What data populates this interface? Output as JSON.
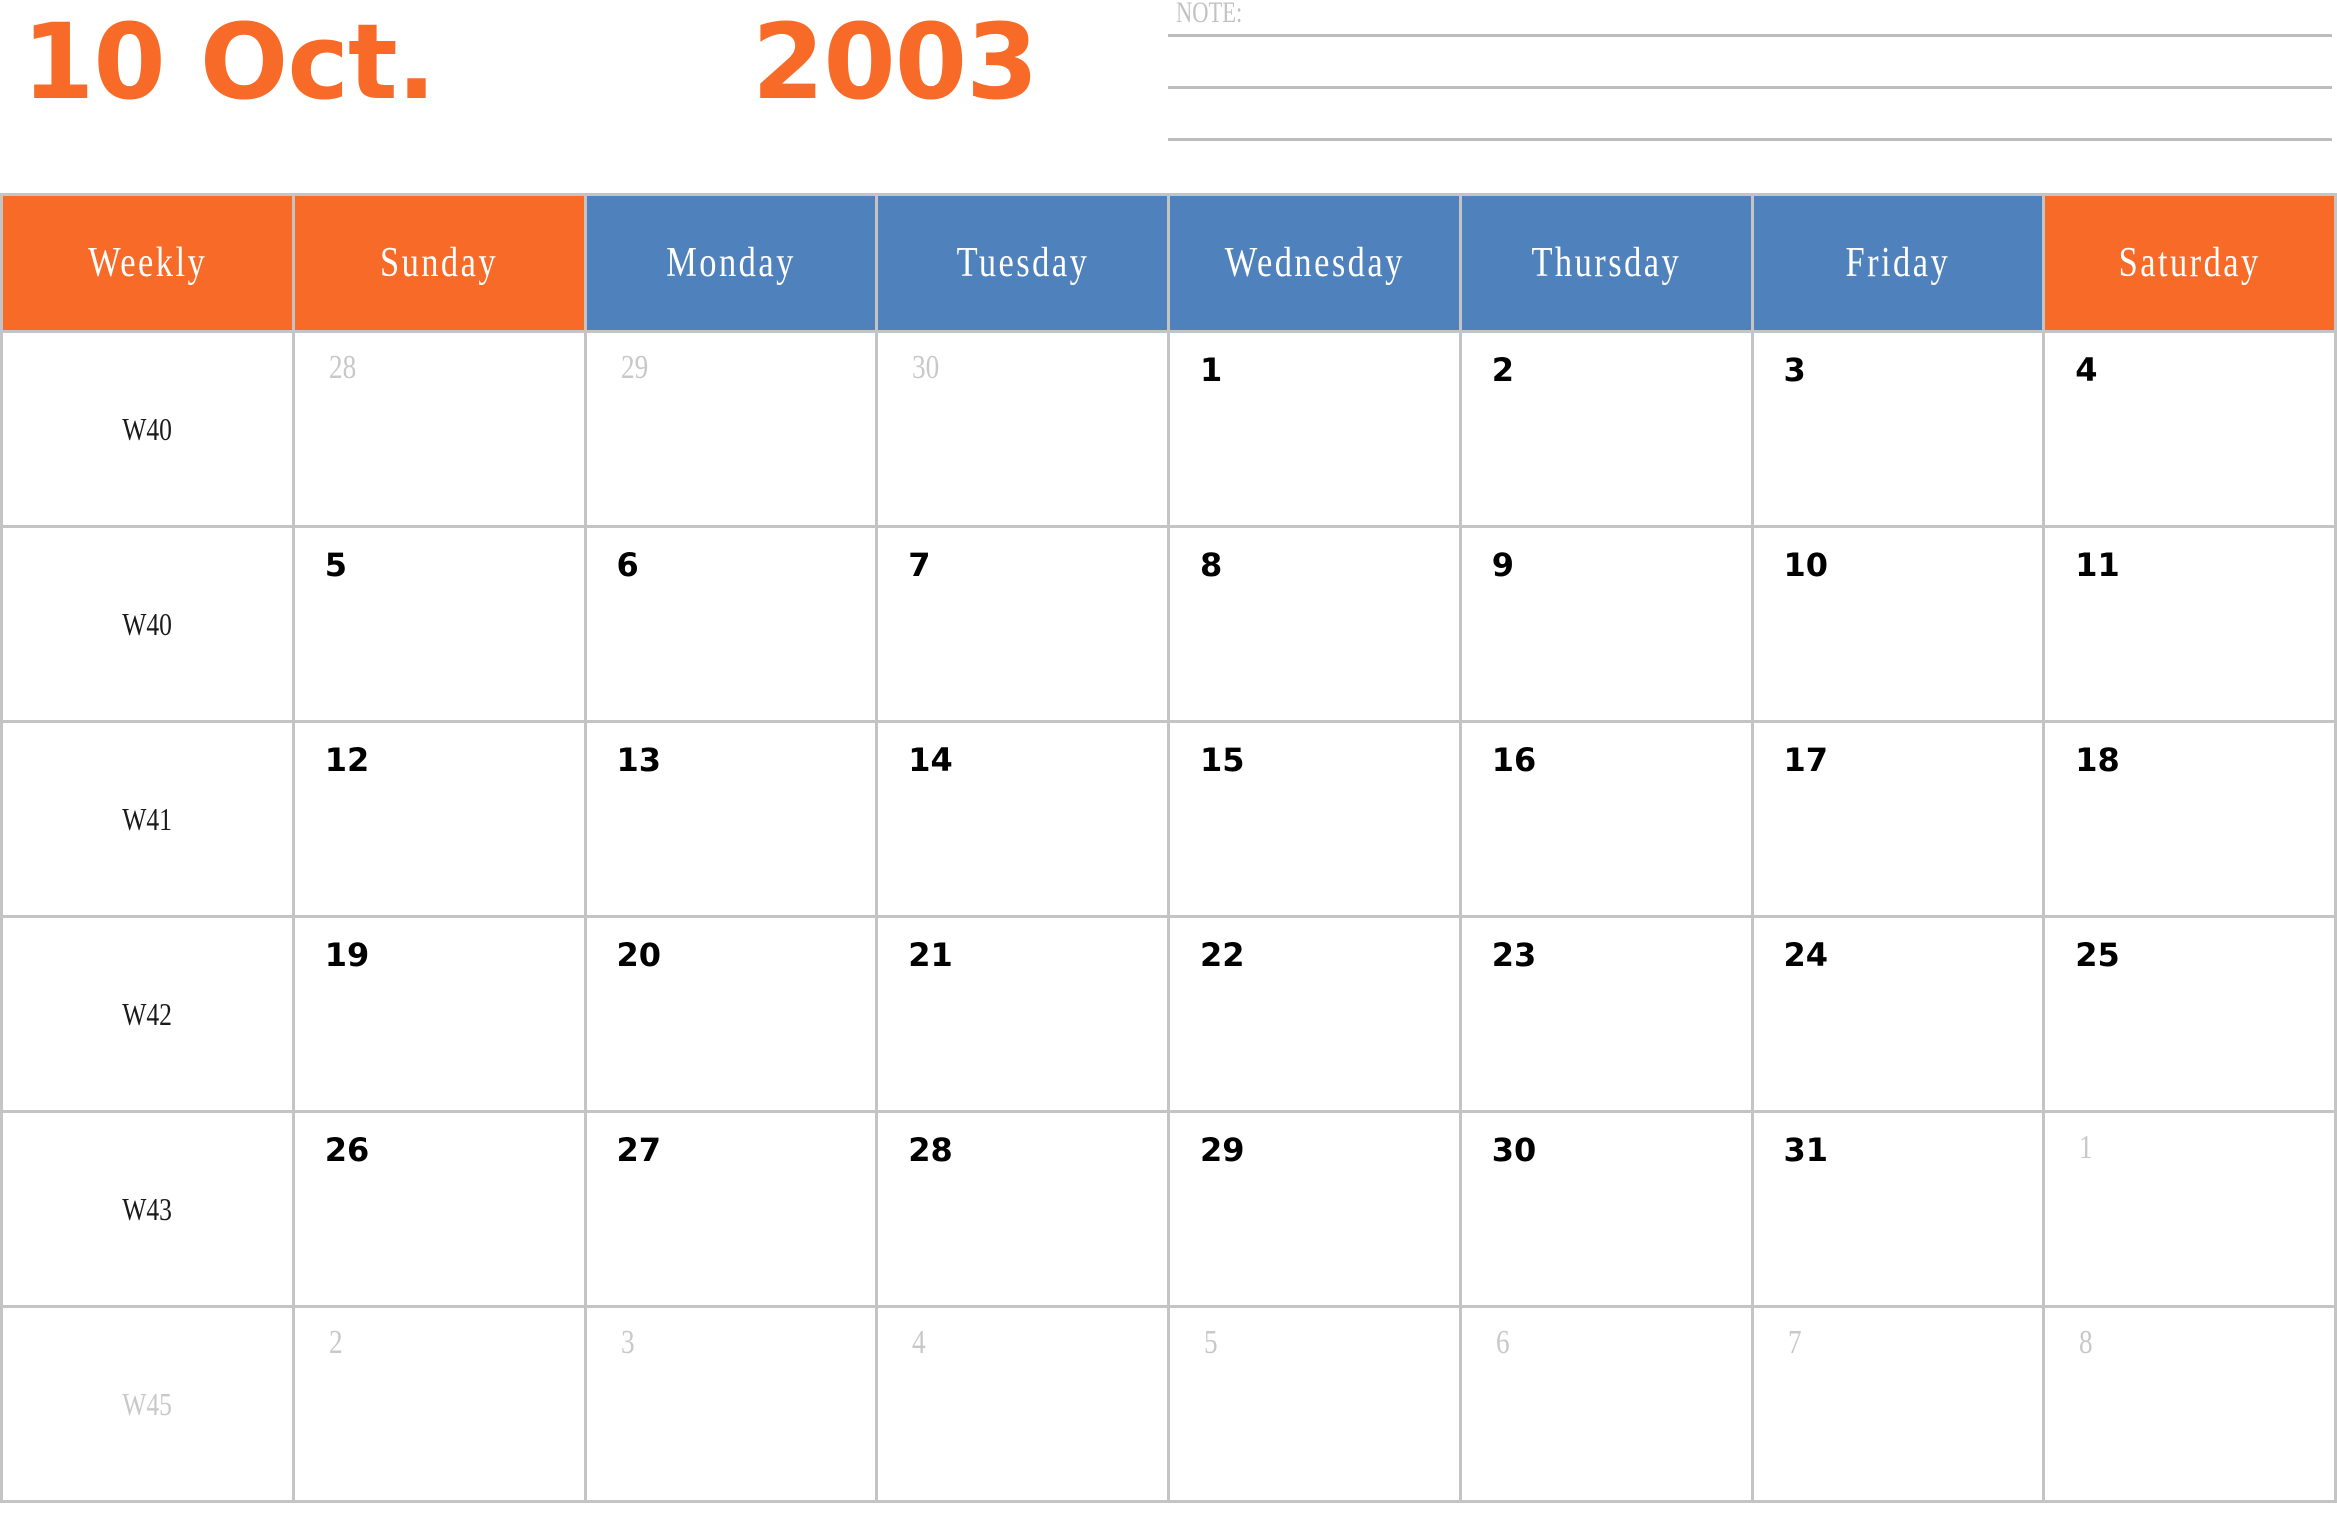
{
  "header": {
    "month_label": "10 Oct.",
    "year_label": "2003",
    "note_label": "NOTE:"
  },
  "colors": {
    "accent_orange": "#f76a27",
    "accent_blue": "#4f81bd",
    "grid": "#c4c4c4",
    "muted_text": "#c8c8c8"
  },
  "calendar": {
    "columns": [
      {
        "label": "Weekly",
        "color": "orange"
      },
      {
        "label": "Sunday",
        "color": "orange"
      },
      {
        "label": "Monday",
        "color": "blue"
      },
      {
        "label": "Tuesday",
        "color": "blue"
      },
      {
        "label": "Wednesday",
        "color": "blue"
      },
      {
        "label": "Thursday",
        "color": "blue"
      },
      {
        "label": "Friday",
        "color": "blue"
      },
      {
        "label": "Saturday",
        "color": "orange"
      }
    ],
    "weeks": [
      {
        "week": "W40",
        "muted": false,
        "days": [
          {
            "d": "28",
            "muted": true
          },
          {
            "d": "29",
            "muted": true
          },
          {
            "d": "30",
            "muted": true
          },
          {
            "d": "1",
            "muted": false
          },
          {
            "d": "2",
            "muted": false
          },
          {
            "d": "3",
            "muted": false
          },
          {
            "d": "4",
            "muted": false
          }
        ]
      },
      {
        "week": "W40",
        "muted": false,
        "days": [
          {
            "d": "5",
            "muted": false
          },
          {
            "d": "6",
            "muted": false
          },
          {
            "d": "7",
            "muted": false
          },
          {
            "d": "8",
            "muted": false
          },
          {
            "d": "9",
            "muted": false
          },
          {
            "d": "10",
            "muted": false
          },
          {
            "d": "11",
            "muted": false
          }
        ]
      },
      {
        "week": "W41",
        "muted": false,
        "days": [
          {
            "d": "12",
            "muted": false
          },
          {
            "d": "13",
            "muted": false
          },
          {
            "d": "14",
            "muted": false
          },
          {
            "d": "15",
            "muted": false
          },
          {
            "d": "16",
            "muted": false
          },
          {
            "d": "17",
            "muted": false
          },
          {
            "d": "18",
            "muted": false
          }
        ]
      },
      {
        "week": "W42",
        "muted": false,
        "days": [
          {
            "d": "19",
            "muted": false
          },
          {
            "d": "20",
            "muted": false
          },
          {
            "d": "21",
            "muted": false
          },
          {
            "d": "22",
            "muted": false
          },
          {
            "d": "23",
            "muted": false
          },
          {
            "d": "24",
            "muted": false
          },
          {
            "d": "25",
            "muted": false
          }
        ]
      },
      {
        "week": "W43",
        "muted": false,
        "days": [
          {
            "d": "26",
            "muted": false
          },
          {
            "d": "27",
            "muted": false
          },
          {
            "d": "28",
            "muted": false
          },
          {
            "d": "29",
            "muted": false
          },
          {
            "d": "30",
            "muted": false
          },
          {
            "d": "31",
            "muted": false
          },
          {
            "d": "1",
            "muted": true
          }
        ]
      },
      {
        "week": "W45",
        "muted": true,
        "days": [
          {
            "d": "2",
            "muted": true
          },
          {
            "d": "3",
            "muted": true
          },
          {
            "d": "4",
            "muted": true
          },
          {
            "d": "5",
            "muted": true
          },
          {
            "d": "6",
            "muted": true
          },
          {
            "d": "7",
            "muted": true
          },
          {
            "d": "8",
            "muted": true
          }
        ]
      }
    ]
  }
}
